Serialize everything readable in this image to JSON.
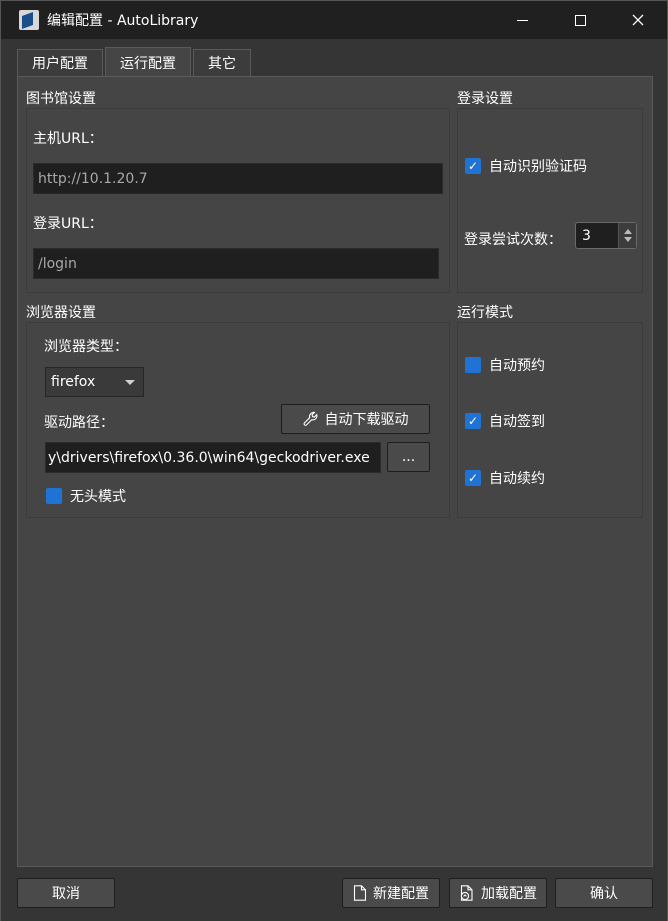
{
  "window": {
    "title": "编辑配置 - AutoLibrary",
    "controls": {
      "minimize": "—",
      "maximize": "☐",
      "close": "✕"
    }
  },
  "tabs": [
    {
      "label": "用户配置",
      "active": false
    },
    {
      "label": "运行配置",
      "active": true
    },
    {
      "label": "其它",
      "active": false
    }
  ],
  "library": {
    "title": "图书馆设置",
    "host_label": "主机URL：",
    "host_value": "http://10.1.20.7",
    "login_label": "登录URL：",
    "login_value": "/login"
  },
  "login": {
    "title": "登录设置",
    "captcha_label": "自动识别验证码",
    "captcha_checked": true,
    "attempts_label": "登录尝试次数：",
    "attempts_value": "3"
  },
  "browser": {
    "title": "浏览器设置",
    "type_label": "浏览器类型：",
    "type_value": "firefox",
    "driver_label": "驱动路径：",
    "download_button": "自动下载驱动",
    "driver_path": "y\\drivers\\firefox\\0.36.0\\win64\\geckodriver.exe",
    "browse_button": "...",
    "headless_label": "无头模式",
    "headless_checked": false
  },
  "run_mode": {
    "title": "运行模式",
    "items": [
      {
        "label": "自动预约",
        "checked": false
      },
      {
        "label": "自动签到",
        "checked": true
      },
      {
        "label": "自动续约",
        "checked": true
      }
    ]
  },
  "footer": {
    "cancel": "取消",
    "new_config": "新建配置",
    "load_config": "加载配置",
    "confirm": "确认"
  },
  "colors": {
    "accent": "#1f73d4",
    "panel": "#454545",
    "titlebar": "#202020"
  }
}
